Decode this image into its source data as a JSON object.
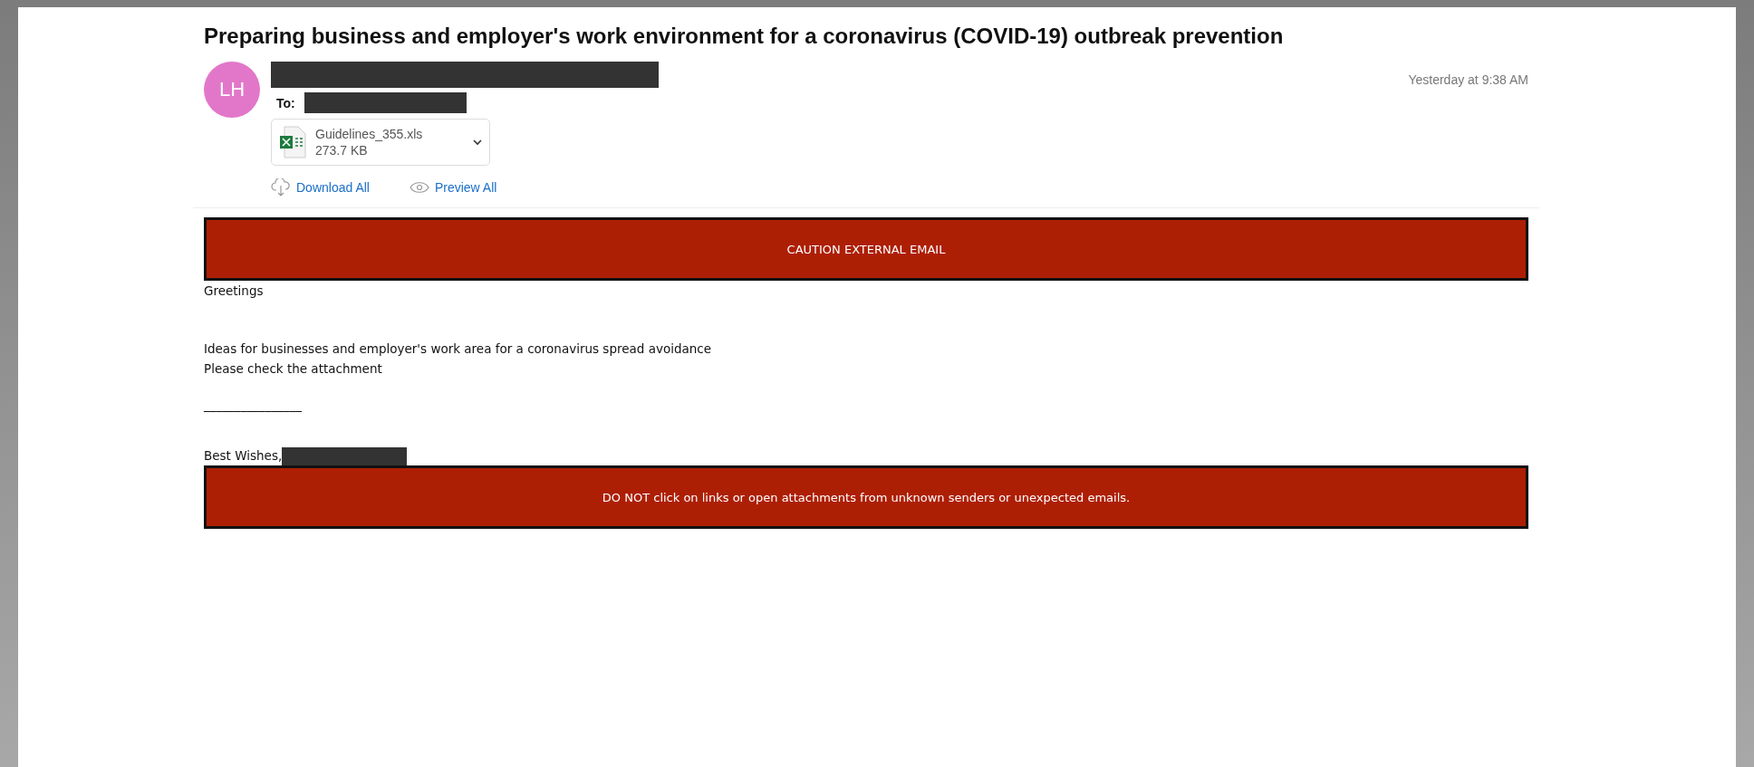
{
  "email": {
    "subject": "Preparing business and employer's work environment for a coronavirus (COVID-19) outbreak prevention",
    "avatar": {
      "initials": "LH",
      "color": "#e277c9"
    },
    "to_label": "To:",
    "time": "Yesterday at 9:38 AM",
    "attachment": {
      "name": "Guidelines_355.xls",
      "size": "273.7 KB"
    },
    "actions": [
      {
        "kind": "download",
        "label": "Download All"
      },
      {
        "kind": "preview",
        "label": "Preview All"
      }
    ]
  },
  "body": {
    "top_banner": "CAUTION EXTERNAL EMAIL",
    "greeting": "Greetings",
    "lines": [
      "Ideas for businesses and employer's work area for a coronavirus spread avoidance",
      "Please check the attachment"
    ],
    "separator": "________________",
    "closing": "Best Wishes,",
    "bottom_banner": "DO NOT click on links or open attachments from unknown senders or unexpected emails."
  }
}
